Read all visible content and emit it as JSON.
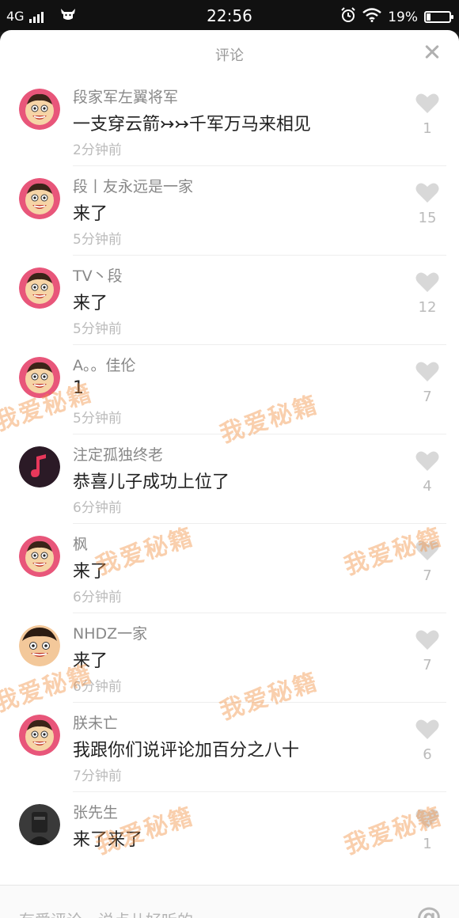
{
  "status_bar": {
    "network": "4G",
    "time": "22:56",
    "battery": "19%",
    "battery_level": 0.19,
    "left_icon": "cow-head-icon",
    "alarm_icon": "alarm-clock-icon",
    "wifi_icon": "wifi-icon"
  },
  "header": {
    "title": "评论",
    "close_icon": "close-icon"
  },
  "comments": [
    {
      "name": "段家军左翼将军",
      "text": "一支穿云箭↣↣千军万马来相见",
      "time": "2分钟前",
      "likes": "1",
      "avatar": "cartoon-monkey"
    },
    {
      "name": "  段丨友永远是一家",
      "text": "来了",
      "time": "5分钟前",
      "likes": "15",
      "avatar": "cartoon-monkey"
    },
    {
      "name": "TV丶段",
      "text": "来了",
      "time": "5分钟前",
      "likes": "12",
      "avatar": "cartoon-monkey"
    },
    {
      "name": "A。。佳伦",
      "text": "1",
      "time": "5分钟前",
      "likes": "7",
      "avatar": "cartoon-monkey"
    },
    {
      "name": "注定孤独终老",
      "text": "恭喜儿子成功上位了",
      "time": "6分钟前",
      "likes": "4",
      "avatar": "music-note"
    },
    {
      "name": "枫",
      "text": "来了",
      "time": "6分钟前",
      "likes": "7",
      "avatar": "cartoon-monkey"
    },
    {
      "name": "NHDZ一家",
      "text": "来了",
      "time": "6分钟前",
      "likes": "7",
      "avatar": "cartoon-face"
    },
    {
      "name": "朕未亡",
      "text": "我跟你们说评论加百分之八十",
      "time": "7分钟前",
      "likes": "6",
      "avatar": "cartoon-monkey"
    },
    {
      "name": "张先生",
      "text": "来了来了",
      "time": "",
      "likes": "1",
      "avatar": "dark-photo"
    }
  ],
  "watermark": {
    "text": "我爱秘籍"
  },
  "input_bar": {
    "placeholder": "有爱评论，说点儿好听的~",
    "at_label": "@"
  },
  "colors": {
    "accent_avatar_ring": "#e8567a",
    "watermark": "#f08c3c",
    "heart": "#d8d8d8"
  }
}
